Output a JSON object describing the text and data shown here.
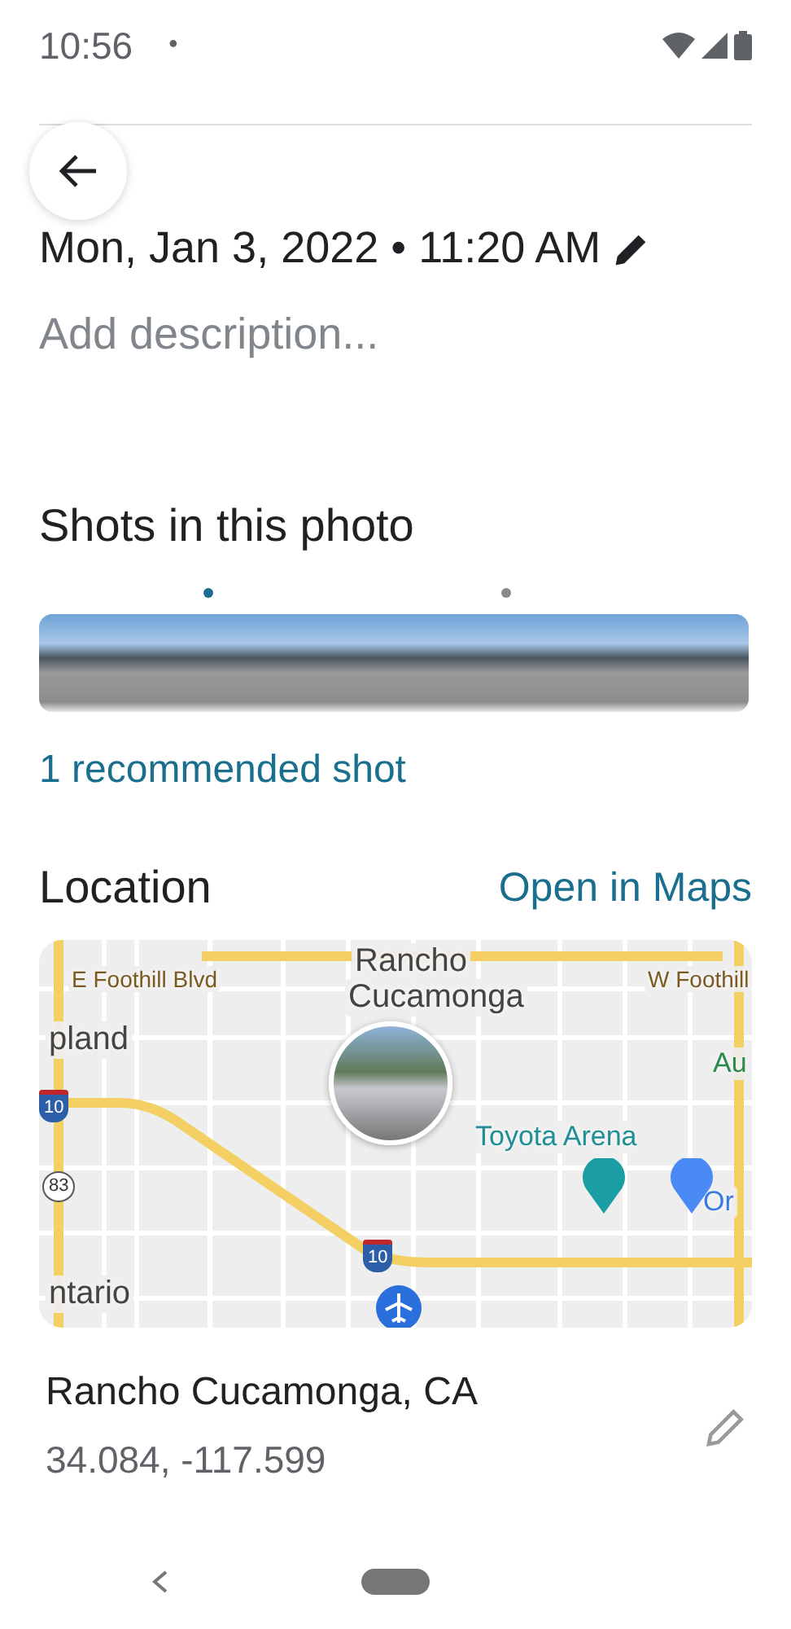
{
  "status_bar": {
    "time": "10:56",
    "notification_dot": "•"
  },
  "date_time": "Mon, Jan 3, 2022 • 11:20 AM",
  "description": {
    "placeholder": "Add description..."
  },
  "shots": {
    "title": "Shots in this photo",
    "markers": [
      {
        "selected": true
      },
      {
        "selected": false
      }
    ],
    "recommended": "1 recommended shot"
  },
  "location": {
    "title": "Location",
    "open_link": "Open in Maps",
    "map_labels": [
      {
        "text": "E Foothill Blvd",
        "kind": "road"
      },
      {
        "text": "Rancho",
        "kind": "city"
      },
      {
        "text": "Cucamonga",
        "kind": "city"
      },
      {
        "text": "W Foothill",
        "kind": "road"
      },
      {
        "text": "pland",
        "kind": "city"
      },
      {
        "text": "Au",
        "kind": "park"
      },
      {
        "text": "Toyota Arena",
        "kind": "poi"
      },
      {
        "text": "Or",
        "kind": "shop"
      },
      {
        "text": "ntario",
        "kind": "city"
      }
    ],
    "shields": [
      {
        "text": "10",
        "kind": "interstate"
      },
      {
        "text": "83",
        "kind": "state"
      },
      {
        "text": "10",
        "kind": "interstate"
      }
    ],
    "place": "Rancho Cucamonga, CA",
    "coordinates": "34.084, -117.599"
  }
}
